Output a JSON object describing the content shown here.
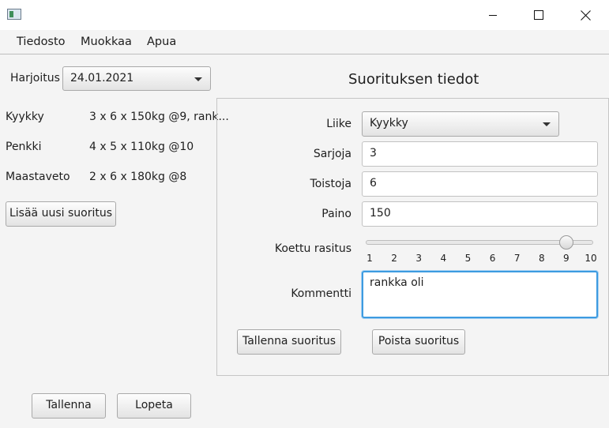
{
  "window": {
    "app_icon": "app-icon",
    "controls": [
      "minimize-icon",
      "maximize-icon",
      "close-icon"
    ]
  },
  "menu": {
    "items": [
      "Tiedosto",
      "Muokkaa",
      "Apua"
    ]
  },
  "left": {
    "workout_label": "Harjoitus",
    "workout_selected": "24.01.2021",
    "exercises": [
      {
        "name": "Kyykky",
        "summary": "3 x 6 x 150kg @9, rank..."
      },
      {
        "name": "Penkki",
        "summary": "4 x 5 x 110kg @10"
      },
      {
        "name": "Maastaveto",
        "summary": "2 x 6 x 180kg @8"
      }
    ],
    "add_button": "Lisää uusi suoritus"
  },
  "details": {
    "title": "Suorituksen tiedot",
    "lift_label": "Liike",
    "lift_value": "Kyykky",
    "sets_label": "Sarjoja",
    "sets_value": "3",
    "reps_label": "Toistoja",
    "reps_value": "6",
    "weight_label": "Paino",
    "weight_value": "150",
    "rpe_label": "Koettu rasitus",
    "rpe_value": 9,
    "rpe_ticks": [
      "1",
      "2",
      "3",
      "4",
      "5",
      "6",
      "7",
      "8",
      "9",
      "10"
    ],
    "comment_label": "Kommentti",
    "comment_value": "rankka oli",
    "save_button": "Tallenna suoritus",
    "delete_button": "Poista suoritus"
  },
  "bottom": {
    "save_button": "Tallenna",
    "quit_button": "Lopeta"
  }
}
